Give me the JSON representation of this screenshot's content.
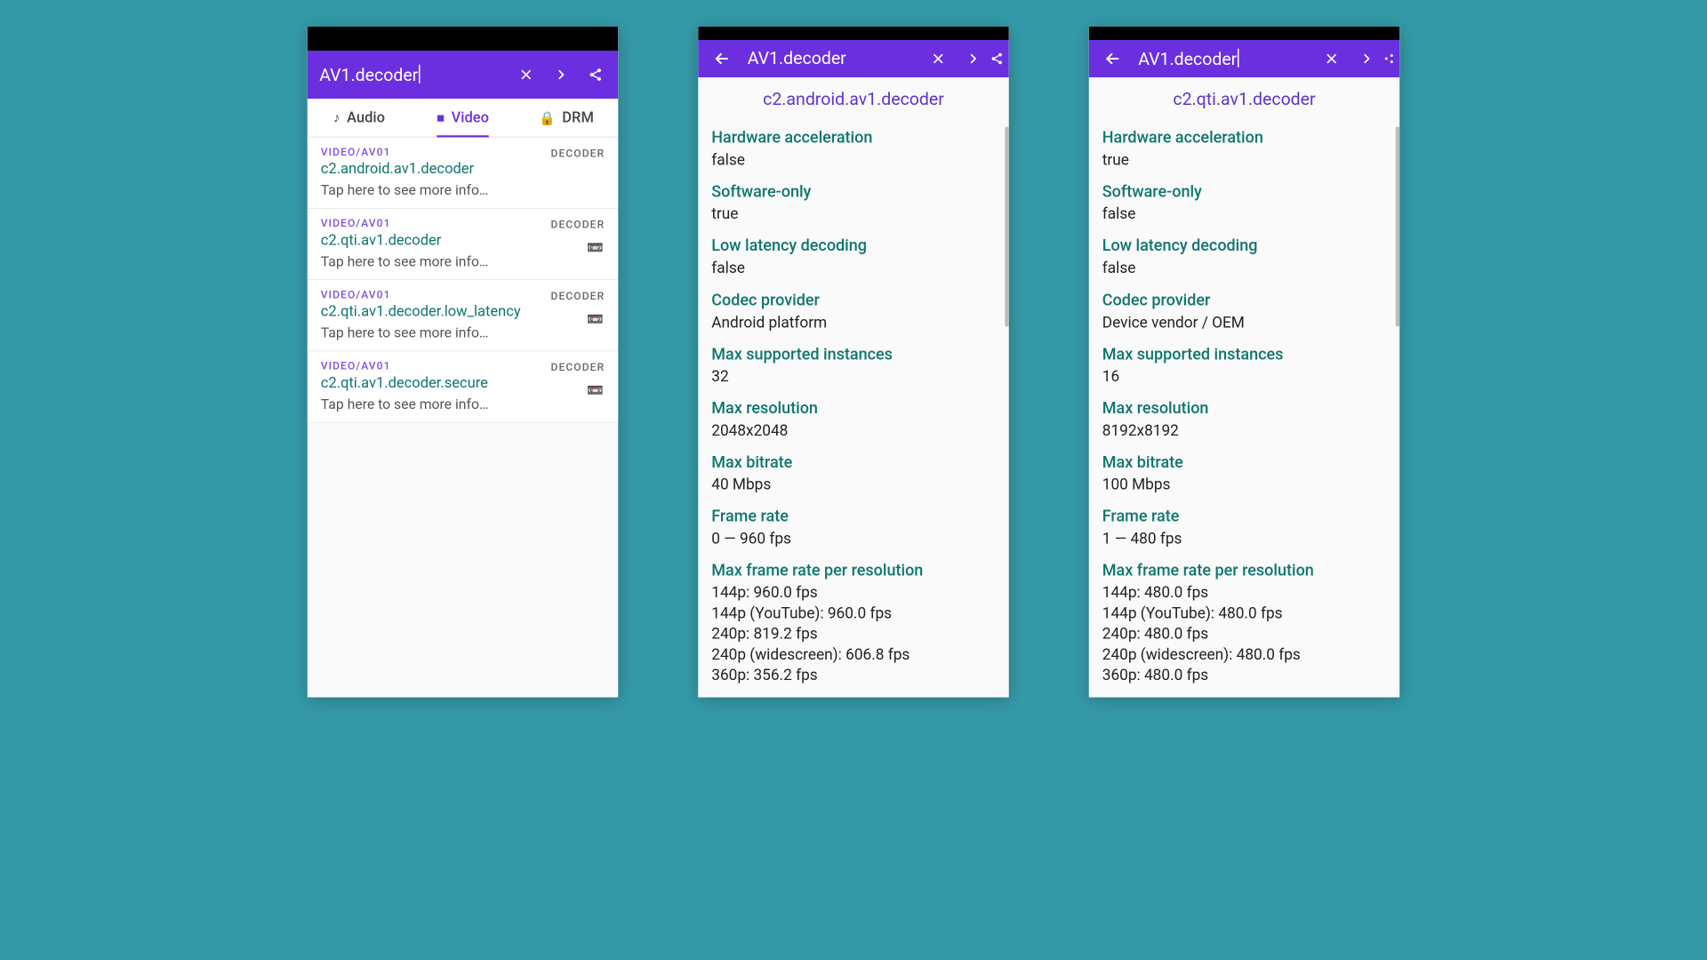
{
  "colors": {
    "accent": "#6b2fe0",
    "teal": "#0f766e",
    "bg": "#359aa8"
  },
  "screen1": {
    "title": "AV1.decoder",
    "cursor": true,
    "actions": {
      "close": "✕",
      "next": "›",
      "share": "share"
    },
    "tabs": [
      {
        "icon": "🎵",
        "label": "Audio",
        "active": false
      },
      {
        "icon": "📹",
        "label": "Video",
        "active": true
      },
      {
        "icon": "🔒",
        "label": "DRM",
        "active": false
      }
    ],
    "rows": [
      {
        "cat": "VIDEO/AV01",
        "badge": "DECODER",
        "name": "c2.android.av1.decoder",
        "hint": "Tap here to see more info…",
        "chip": false
      },
      {
        "cat": "VIDEO/AV01",
        "badge": "DECODER",
        "name": "c2.qti.av1.decoder",
        "hint": "Tap here to see more info…",
        "chip": true
      },
      {
        "cat": "VIDEO/AV01",
        "badge": "DECODER",
        "name": "c2.qti.av1.decoder.low_latency",
        "hint": "Tap here to see more info…",
        "chip": true
      },
      {
        "cat": "VIDEO/AV01",
        "badge": "DECODER",
        "name": "c2.qti.av1.decoder.secure",
        "hint": "Tap here to see more info…",
        "chip": true
      }
    ]
  },
  "screen2": {
    "title": "AV1.decoder",
    "detail_title": "c2.android.av1.decoder",
    "props": [
      {
        "k": "Hardware acceleration",
        "v": "false"
      },
      {
        "k": "Software-only",
        "v": "true"
      },
      {
        "k": "Low latency decoding",
        "v": "false"
      },
      {
        "k": "Codec provider",
        "v": "Android platform"
      },
      {
        "k": "Max supported instances",
        "v": "32"
      },
      {
        "k": "Max resolution",
        "v": "2048x2048"
      },
      {
        "k": "Max bitrate",
        "v": "40 Mbps"
      },
      {
        "k": "Frame rate",
        "v": "0 — 960 fps"
      },
      {
        "k": "Max frame rate per resolution",
        "v": "144p: 960.0 fps\n144p (YouTube): 960.0 fps\n240p: 819.2 fps\n240p (widescreen): 606.8 fps\n360p: 356.2 fps"
      }
    ]
  },
  "screen3": {
    "title": "AV1.decoder",
    "cursor": true,
    "detail_title": "c2.qti.av1.decoder",
    "props": [
      {
        "k": "Hardware acceleration",
        "v": "true"
      },
      {
        "k": "Software-only",
        "v": "false"
      },
      {
        "k": "Low latency decoding",
        "v": "false"
      },
      {
        "k": "Codec provider",
        "v": "Device vendor / OEM"
      },
      {
        "k": "Max supported instances",
        "v": "16"
      },
      {
        "k": "Max resolution",
        "v": "8192x8192"
      },
      {
        "k": "Max bitrate",
        "v": "100 Mbps"
      },
      {
        "k": "Frame rate",
        "v": "1 — 480 fps"
      },
      {
        "k": "Max frame rate per resolution",
        "v": "144p: 480.0 fps\n144p (YouTube): 480.0 fps\n240p: 480.0 fps\n240p (widescreen): 480.0 fps\n360p: 480.0 fps"
      }
    ]
  },
  "icons": {
    "back": "←",
    "close": "✕",
    "next": "›",
    "share": "⋔",
    "hw": "📹"
  }
}
